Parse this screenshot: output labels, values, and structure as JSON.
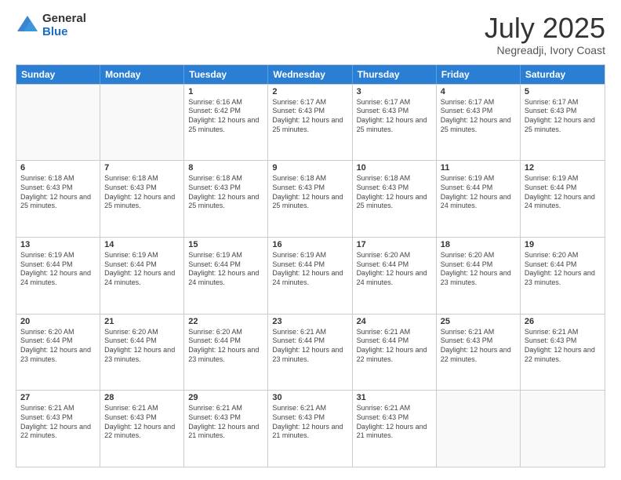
{
  "logo": {
    "general": "General",
    "blue": "Blue"
  },
  "title": "July 2025",
  "subtitle": "Negreadji, Ivory Coast",
  "header_days": [
    "Sunday",
    "Monday",
    "Tuesday",
    "Wednesday",
    "Thursday",
    "Friday",
    "Saturday"
  ],
  "weeks": [
    [
      {
        "day": "",
        "info": ""
      },
      {
        "day": "",
        "info": ""
      },
      {
        "day": "1",
        "info": "Sunrise: 6:16 AM\nSunset: 6:42 PM\nDaylight: 12 hours and 25 minutes."
      },
      {
        "day": "2",
        "info": "Sunrise: 6:17 AM\nSunset: 6:43 PM\nDaylight: 12 hours and 25 minutes."
      },
      {
        "day": "3",
        "info": "Sunrise: 6:17 AM\nSunset: 6:43 PM\nDaylight: 12 hours and 25 minutes."
      },
      {
        "day": "4",
        "info": "Sunrise: 6:17 AM\nSunset: 6:43 PM\nDaylight: 12 hours and 25 minutes."
      },
      {
        "day": "5",
        "info": "Sunrise: 6:17 AM\nSunset: 6:43 PM\nDaylight: 12 hours and 25 minutes."
      }
    ],
    [
      {
        "day": "6",
        "info": "Sunrise: 6:18 AM\nSunset: 6:43 PM\nDaylight: 12 hours and 25 minutes."
      },
      {
        "day": "7",
        "info": "Sunrise: 6:18 AM\nSunset: 6:43 PM\nDaylight: 12 hours and 25 minutes."
      },
      {
        "day": "8",
        "info": "Sunrise: 6:18 AM\nSunset: 6:43 PM\nDaylight: 12 hours and 25 minutes."
      },
      {
        "day": "9",
        "info": "Sunrise: 6:18 AM\nSunset: 6:43 PM\nDaylight: 12 hours and 25 minutes."
      },
      {
        "day": "10",
        "info": "Sunrise: 6:18 AM\nSunset: 6:43 PM\nDaylight: 12 hours and 25 minutes."
      },
      {
        "day": "11",
        "info": "Sunrise: 6:19 AM\nSunset: 6:44 PM\nDaylight: 12 hours and 24 minutes."
      },
      {
        "day": "12",
        "info": "Sunrise: 6:19 AM\nSunset: 6:44 PM\nDaylight: 12 hours and 24 minutes."
      }
    ],
    [
      {
        "day": "13",
        "info": "Sunrise: 6:19 AM\nSunset: 6:44 PM\nDaylight: 12 hours and 24 minutes."
      },
      {
        "day": "14",
        "info": "Sunrise: 6:19 AM\nSunset: 6:44 PM\nDaylight: 12 hours and 24 minutes."
      },
      {
        "day": "15",
        "info": "Sunrise: 6:19 AM\nSunset: 6:44 PM\nDaylight: 12 hours and 24 minutes."
      },
      {
        "day": "16",
        "info": "Sunrise: 6:19 AM\nSunset: 6:44 PM\nDaylight: 12 hours and 24 minutes."
      },
      {
        "day": "17",
        "info": "Sunrise: 6:20 AM\nSunset: 6:44 PM\nDaylight: 12 hours and 24 minutes."
      },
      {
        "day": "18",
        "info": "Sunrise: 6:20 AM\nSunset: 6:44 PM\nDaylight: 12 hours and 23 minutes."
      },
      {
        "day": "19",
        "info": "Sunrise: 6:20 AM\nSunset: 6:44 PM\nDaylight: 12 hours and 23 minutes."
      }
    ],
    [
      {
        "day": "20",
        "info": "Sunrise: 6:20 AM\nSunset: 6:44 PM\nDaylight: 12 hours and 23 minutes."
      },
      {
        "day": "21",
        "info": "Sunrise: 6:20 AM\nSunset: 6:44 PM\nDaylight: 12 hours and 23 minutes."
      },
      {
        "day": "22",
        "info": "Sunrise: 6:20 AM\nSunset: 6:44 PM\nDaylight: 12 hours and 23 minutes."
      },
      {
        "day": "23",
        "info": "Sunrise: 6:21 AM\nSunset: 6:44 PM\nDaylight: 12 hours and 23 minutes."
      },
      {
        "day": "24",
        "info": "Sunrise: 6:21 AM\nSunset: 6:44 PM\nDaylight: 12 hours and 22 minutes."
      },
      {
        "day": "25",
        "info": "Sunrise: 6:21 AM\nSunset: 6:43 PM\nDaylight: 12 hours and 22 minutes."
      },
      {
        "day": "26",
        "info": "Sunrise: 6:21 AM\nSunset: 6:43 PM\nDaylight: 12 hours and 22 minutes."
      }
    ],
    [
      {
        "day": "27",
        "info": "Sunrise: 6:21 AM\nSunset: 6:43 PM\nDaylight: 12 hours and 22 minutes."
      },
      {
        "day": "28",
        "info": "Sunrise: 6:21 AM\nSunset: 6:43 PM\nDaylight: 12 hours and 22 minutes."
      },
      {
        "day": "29",
        "info": "Sunrise: 6:21 AM\nSunset: 6:43 PM\nDaylight: 12 hours and 21 minutes."
      },
      {
        "day": "30",
        "info": "Sunrise: 6:21 AM\nSunset: 6:43 PM\nDaylight: 12 hours and 21 minutes."
      },
      {
        "day": "31",
        "info": "Sunrise: 6:21 AM\nSunset: 6:43 PM\nDaylight: 12 hours and 21 minutes."
      },
      {
        "day": "",
        "info": ""
      },
      {
        "day": "",
        "info": ""
      }
    ]
  ]
}
